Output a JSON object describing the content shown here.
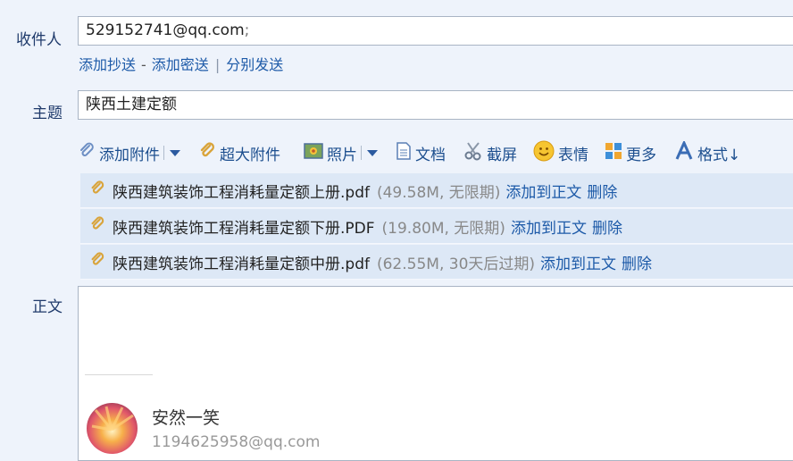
{
  "labels": {
    "to": "收件人",
    "subject": "主题",
    "body": "正文"
  },
  "to": {
    "value": "529152741@qq.com",
    "separator": ";"
  },
  "cc_row": {
    "add_cc": "添加抄送",
    "dash": "-",
    "add_bcc": "添加密送",
    "bar": "|",
    "separate_send": "分别发送"
  },
  "subject": {
    "value": "陕西土建定额"
  },
  "toolbar": {
    "attach": "添加附件",
    "big_attach": "超大附件",
    "photo": "照片",
    "doc": "文档",
    "screenshot": "截屏",
    "emoji": "表情",
    "more": "更多",
    "format": "格式↓"
  },
  "attachments": [
    {
      "name": "陕西建筑装饰工程消耗量定额上册.pdf",
      "meta": "(49.58M, 无限期)",
      "add": "添加到正文",
      "del": "删除"
    },
    {
      "name": "陕西建筑装饰工程消耗量定额下册.PDF",
      "meta": "(19.80M, 无限期)",
      "add": "添加到正文",
      "del": "删除"
    },
    {
      "name": "陕西建筑装饰工程消耗量定额中册.pdf",
      "meta": "(62.55M, 30天后过期)",
      "add": "添加到正文",
      "del": "删除"
    }
  ],
  "signature": {
    "name": "安然一笑",
    "email": "1194625958@qq.com"
  },
  "colors": {
    "link": "#1d5aa8",
    "label": "#1f3a6b",
    "attach_bg": "#dde8f6",
    "page_bg": "#eef3fb"
  }
}
